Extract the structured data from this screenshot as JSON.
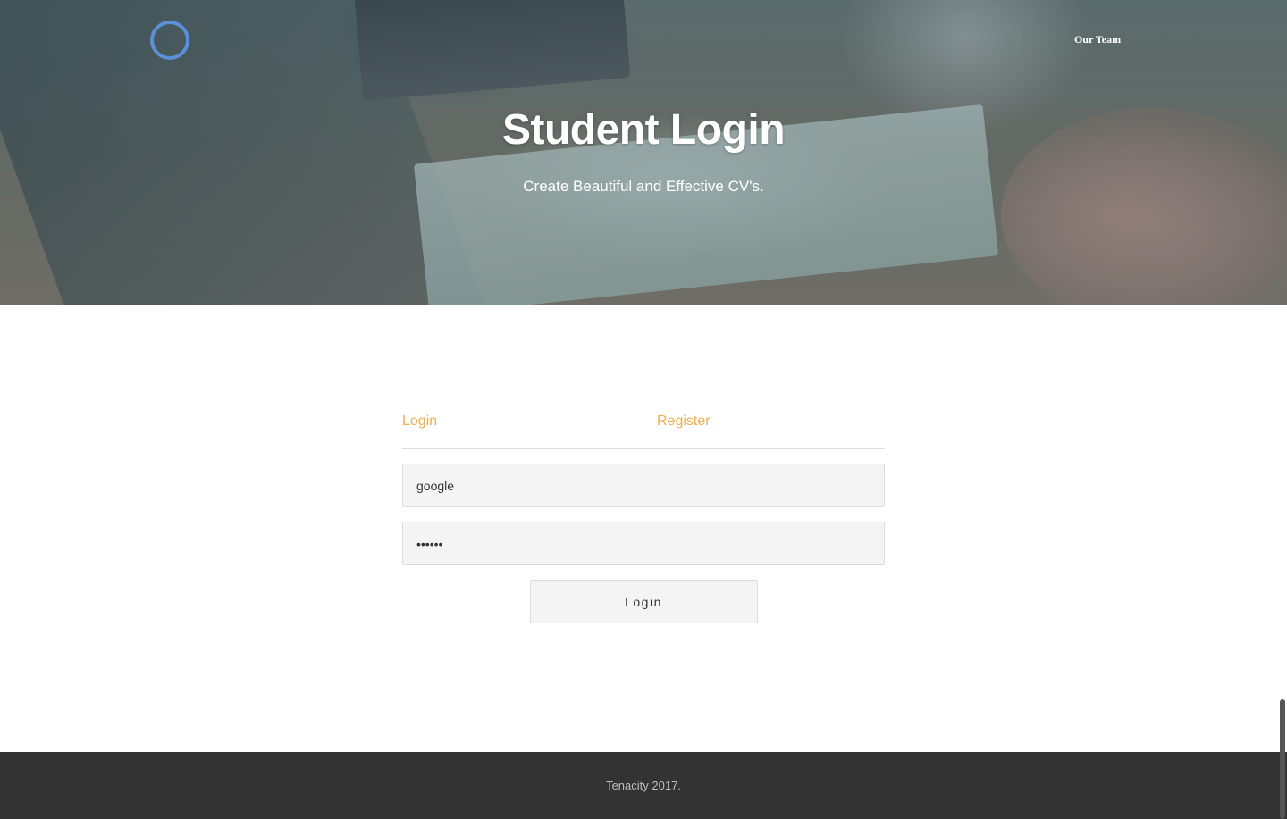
{
  "nav": {
    "logo_icon": "ring-logo-icon",
    "our_team": "Our Team"
  },
  "hero": {
    "title": "Student Login",
    "subtitle": "Create Beautiful and Effective CV's."
  },
  "form": {
    "tabs": {
      "login": "Login",
      "register": "Register"
    },
    "username_value": "google",
    "password_value": "••••••",
    "submit_label": "Login"
  },
  "footer": {
    "text": "Tenacity 2017."
  },
  "colors": {
    "accent": "#f0ad4e",
    "logo_ring": "#5b8fd6",
    "footer_bg": "#333333",
    "field_bg": "#f4f4f4"
  }
}
